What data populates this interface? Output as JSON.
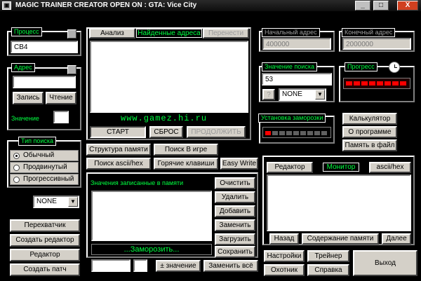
{
  "window": {
    "title": "MAGIC TRAINER CREATOR OPEN ON : GTA: Vice City",
    "controls": [
      "_",
      "□",
      "X"
    ]
  },
  "process": {
    "title": "Процесс",
    "value": "CB4"
  },
  "address": {
    "title": "Адрес",
    "value": "",
    "write": "Запись",
    "read": "Чтение",
    "value_label": "Значение"
  },
  "search_type": {
    "title": "Тип поиска",
    "options": [
      "Обычный",
      "Продвинутый",
      "Прогрессивный"
    ],
    "selected": 0,
    "combo": "NONE"
  },
  "left_buttons": [
    "Перехватчик",
    "Создать редактор",
    "Редактор",
    "Создать патч"
  ],
  "results": {
    "tabs": [
      "Анализ",
      "Найденные адреса",
      "Перенести"
    ],
    "url": "www.gamez.hi.ru",
    "start": "СТАРТ",
    "reset": "СБРОС",
    "continue": "ПРОДОЛЖИТЬ"
  },
  "mid_buttons": [
    "Структура памяти",
    "Поиск В игре",
    "Поиск ascii/hex",
    "Горячие клавиши",
    "Easy Write"
  ],
  "saved": {
    "title": "Значения записанные в памяти",
    "buttons": [
      "Очистить",
      "Удалить",
      "Добавить",
      "Заменить",
      "Загрузить",
      "Сохранить"
    ],
    "freeze": "...Заморозить...",
    "pm_value": "± значение",
    "replace_all": "Заменить всё"
  },
  "start_addr": {
    "title": "Начальный адрес",
    "value": "400000"
  },
  "end_addr": {
    "title": "Конечный адрес",
    "value": "2000000"
  },
  "search_value": {
    "title": "Значение поиска",
    "value": "53",
    "help": "?",
    "combo": "NONE"
  },
  "progress": {
    "title": "Прогресс",
    "level": 0
  },
  "freeze_setup": {
    "title": "Установка заморозки"
  },
  "right_buttons": [
    "Калькулятор",
    "О программе",
    "Память в файл"
  ],
  "monitor": {
    "editor": "Редактор",
    "title": "Монитор",
    "asciihex": "ascii/hex",
    "back": "Назад",
    "content": "Содержание памяти",
    "next": "Далее"
  },
  "bottom": {
    "settings": "Настройки",
    "trainer": "Трейнер",
    "hunter": "Охотник",
    "help": "Справка",
    "exit": "Выход"
  },
  "colors": {
    "accent": "#00ff40",
    "led": "#ff0000",
    "face": "#d4d0c8"
  }
}
